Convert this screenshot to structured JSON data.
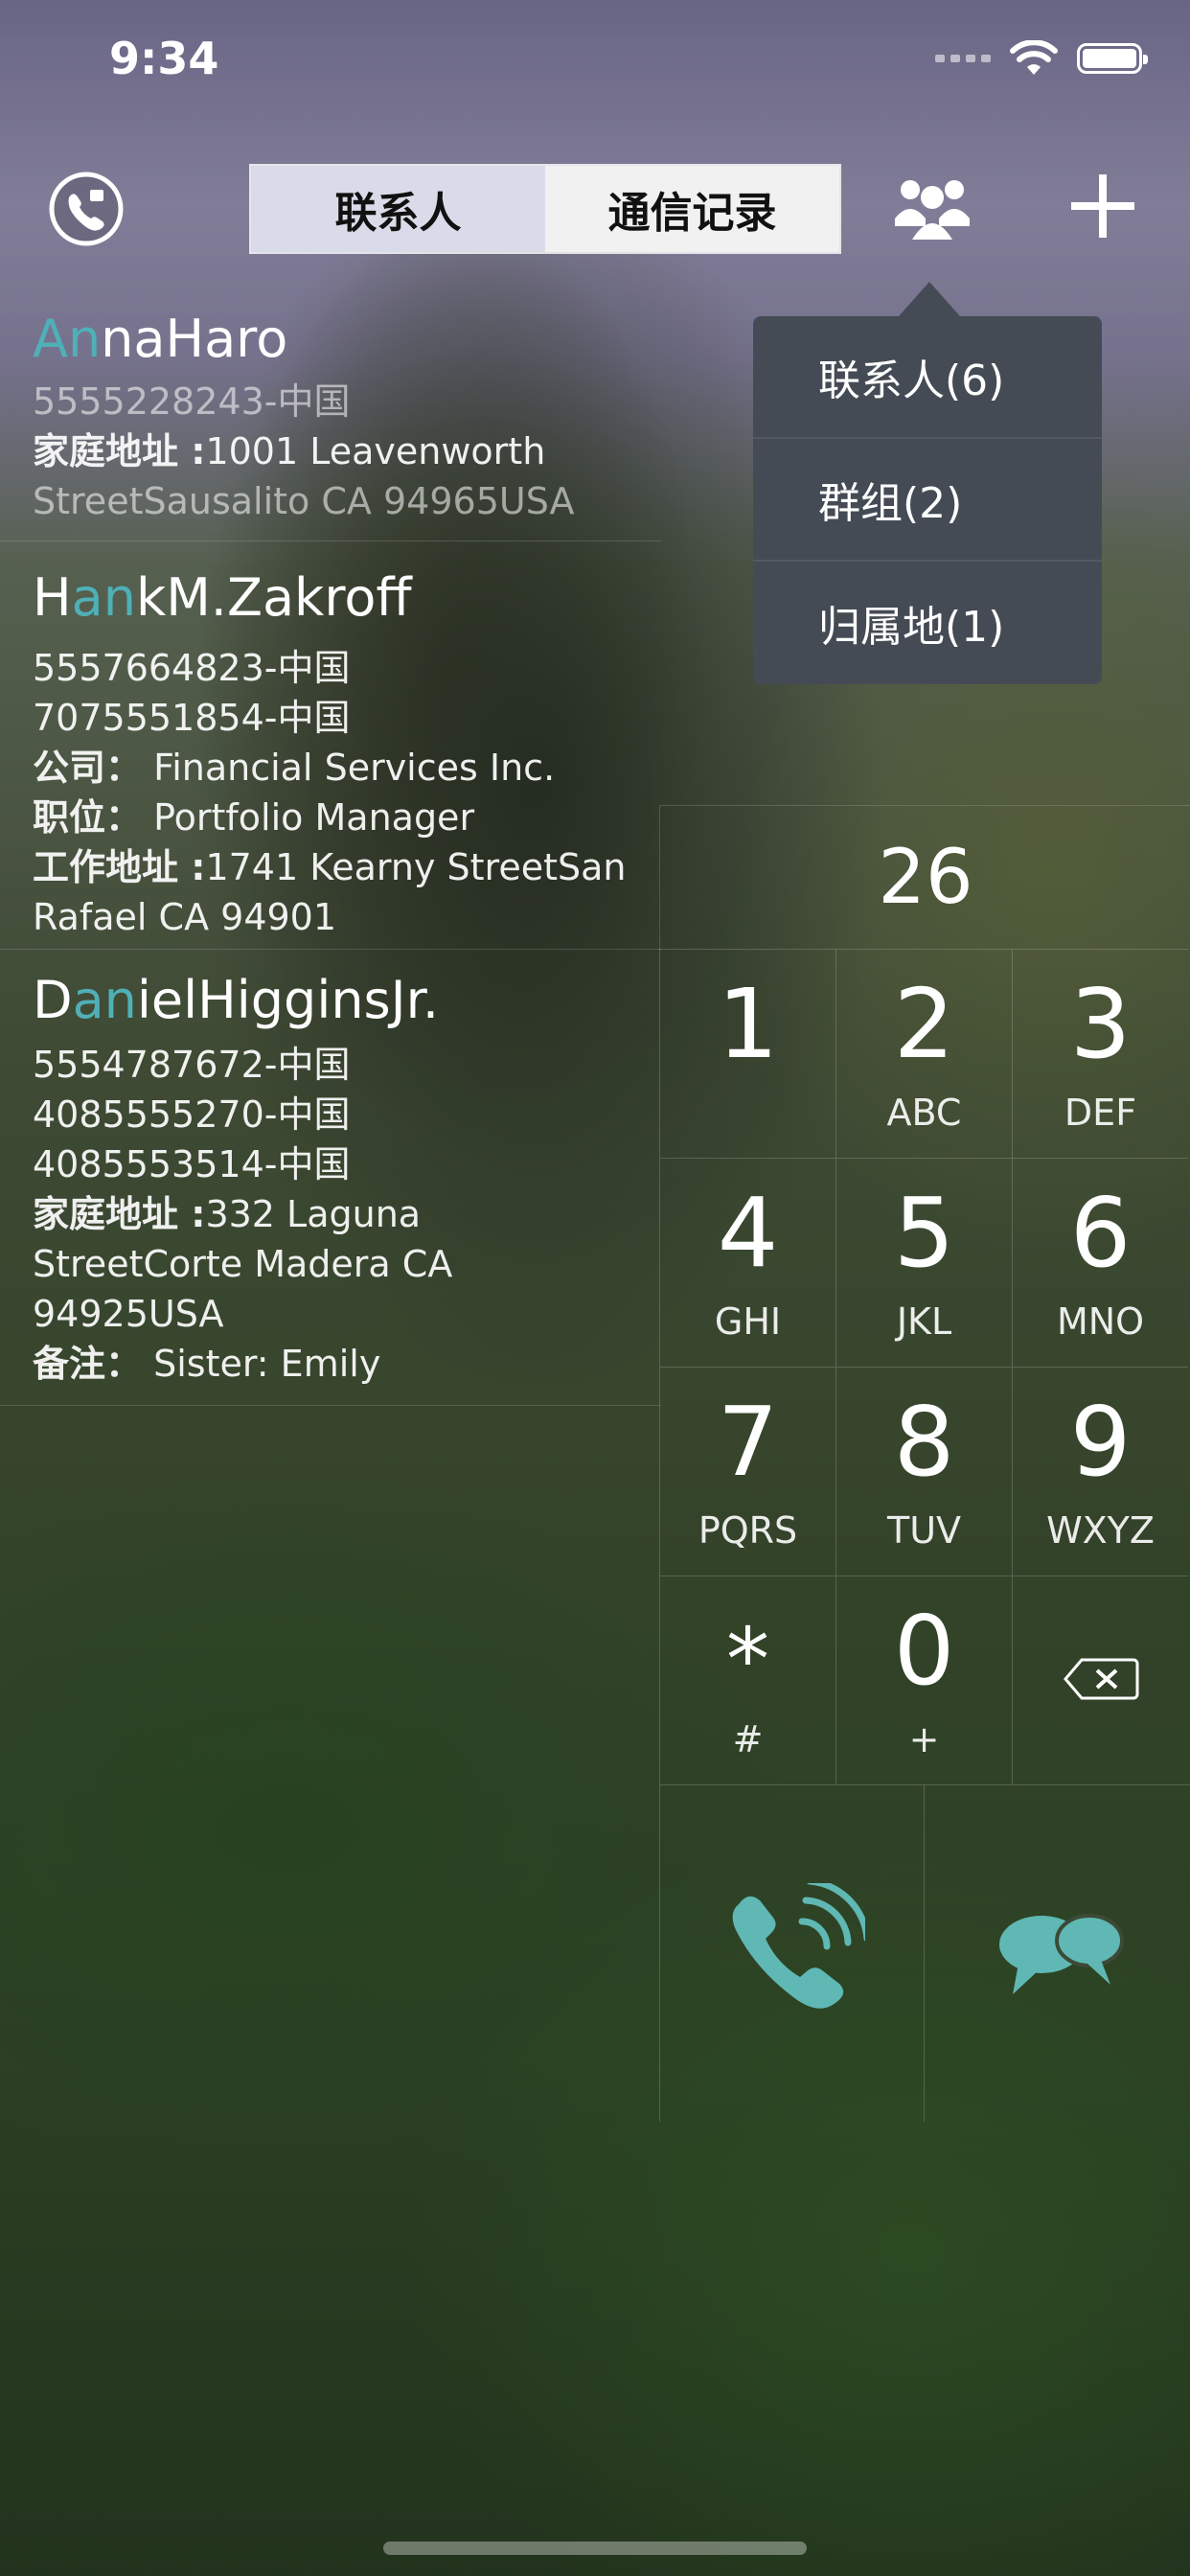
{
  "status_bar": {
    "time": "9:34"
  },
  "nav": {
    "tabs": [
      {
        "label": "联系人",
        "active": true
      },
      {
        "label": "通信记录",
        "active": false
      }
    ],
    "icons": [
      "phone-settings-icon",
      "group-icon",
      "plus-icon"
    ]
  },
  "dropdown": {
    "items": [
      {
        "label": "联系人(6)"
      },
      {
        "label": "群组(2)"
      },
      {
        "label": "归属地(1)"
      }
    ]
  },
  "contacts": [
    {
      "name_hl": "An",
      "name_pre": "",
      "name_post": "naHaro",
      "lines": [
        {
          "label": "",
          "value": "5555228243-中国"
        },
        {
          "label": "家庭地址 :",
          "value": "1001  Leavenworth"
        },
        {
          "label": "",
          "value": "StreetSausalito CA 94965USA"
        }
      ]
    },
    {
      "name_pre": "H",
      "name_hl": "an",
      "name_post": "kM.Zakroff",
      "lines": [
        {
          "label": "",
          "value": "5557664823-中国"
        },
        {
          "label": "",
          "value": "7075551854-中国"
        },
        {
          "label": "公司：",
          "value": " Financial Services Inc."
        },
        {
          "label": "职位：",
          "value": " Portfolio Manager"
        },
        {
          "label": "工作地址 :",
          "value": "1741 Kearny StreetSan"
        },
        {
          "label": "",
          "value": "Rafael CA 94901"
        }
      ]
    },
    {
      "name_pre": "D",
      "name_hl": "an",
      "name_post": "ielHigginsJr.",
      "lines": [
        {
          "label": "",
          "value": "5554787672-中国"
        },
        {
          "label": "",
          "value": "4085555270-中国"
        },
        {
          "label": "",
          "value": "4085553514-中国"
        },
        {
          "label": "家庭地址 :",
          "value": "332 Laguna"
        },
        {
          "label": "",
          "value": "StreetCorte Madera CA"
        },
        {
          "label": "",
          "value": "94925USA"
        },
        {
          "label": "备注：",
          "value": " Sister: Emily"
        }
      ]
    }
  ],
  "dialpad": {
    "display": "26",
    "keys": [
      {
        "digit": "1",
        "letters": ""
      },
      {
        "digit": "2",
        "letters": "ABC"
      },
      {
        "digit": "3",
        "letters": "DEF"
      },
      {
        "digit": "4",
        "letters": "GHI"
      },
      {
        "digit": "5",
        "letters": "JKL"
      },
      {
        "digit": "6",
        "letters": "MNO"
      },
      {
        "digit": "7",
        "letters": "PQRS"
      },
      {
        "digit": "8",
        "letters": "TUV"
      },
      {
        "digit": "9",
        "letters": "WXYZ"
      },
      {
        "digit": "*",
        "letters": "#"
      },
      {
        "digit": "0",
        "letters": "+"
      },
      {
        "digit": "",
        "letters": "",
        "icon": "backspace-icon"
      }
    ],
    "actions": [
      "call-icon",
      "message-icon"
    ],
    "accent_color": "#5fb8b4"
  }
}
